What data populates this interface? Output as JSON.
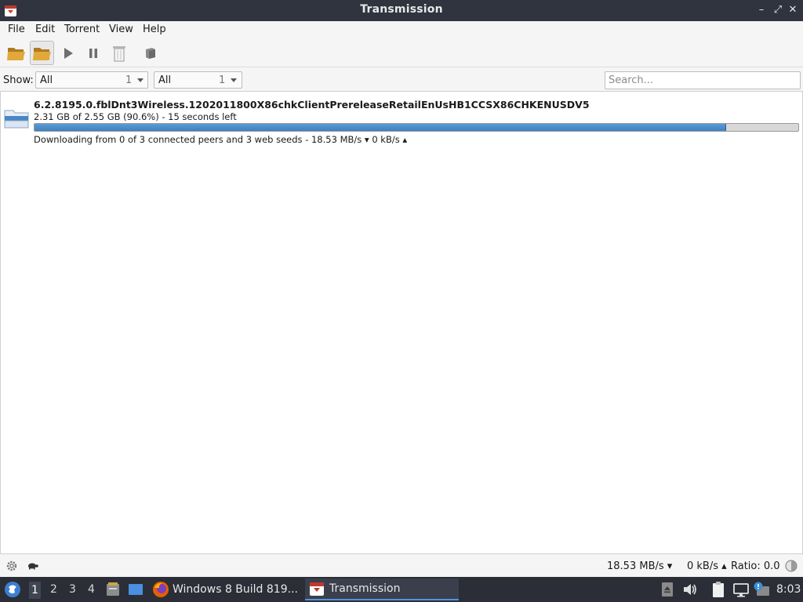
{
  "window": {
    "title": "Transmission",
    "minimize_label": "–",
    "maximize_label": "⤢",
    "close_label": "✕"
  },
  "menu": {
    "file": "File",
    "edit": "Edit",
    "torrent": "Torrent",
    "view": "View",
    "help": "Help"
  },
  "toolbar": {
    "icons": [
      "open-folder-icon",
      "open-folder-icon",
      "play-icon",
      "pause-icon",
      "trash-icon",
      "properties-icon"
    ]
  },
  "filter": {
    "show_label": "Show:",
    "activity": {
      "value": "All",
      "count": "1"
    },
    "tracker": {
      "value": "All",
      "count": "1"
    },
    "search_placeholder": "Search..."
  },
  "torrents": [
    {
      "name": "6.2.8195.0.fblDnt3Wireless.1202011800X86chkClientPrereleaseRetailEnUsHB1CCSX86CHKENUSDV5",
      "progress_text": "2.31 GB of 2.55 GB (90.6%) - 15 seconds left",
      "progress_fraction": 0.906,
      "status_text": "Downloading from 0 of 3 connected peers and 3 web seeds - 18.53 MB/s ▾  0 kB/s ▴",
      "icon": "folder-icon"
    }
  ],
  "statusbar": {
    "download_speed": "18.53 MB/s ▾",
    "upload_speed": "0 kB/s ▴",
    "ratio": "Ratio: 0.0"
  },
  "taskbar": {
    "workspaces": [
      "1",
      "2",
      "3",
      "4"
    ],
    "active_workspace": "1",
    "tasks": [
      {
        "label": "Windows 8 Build 819...",
        "icon": "firefox-icon",
        "active": false
      },
      {
        "label": "Transmission",
        "icon": "transmission-icon",
        "active": true
      }
    ],
    "clock": "8:03"
  },
  "colors": {
    "titlebar_bg": "#2f343f",
    "progress_fill": "#4a8bc9",
    "taskbar_bg": "#2b2e37"
  }
}
